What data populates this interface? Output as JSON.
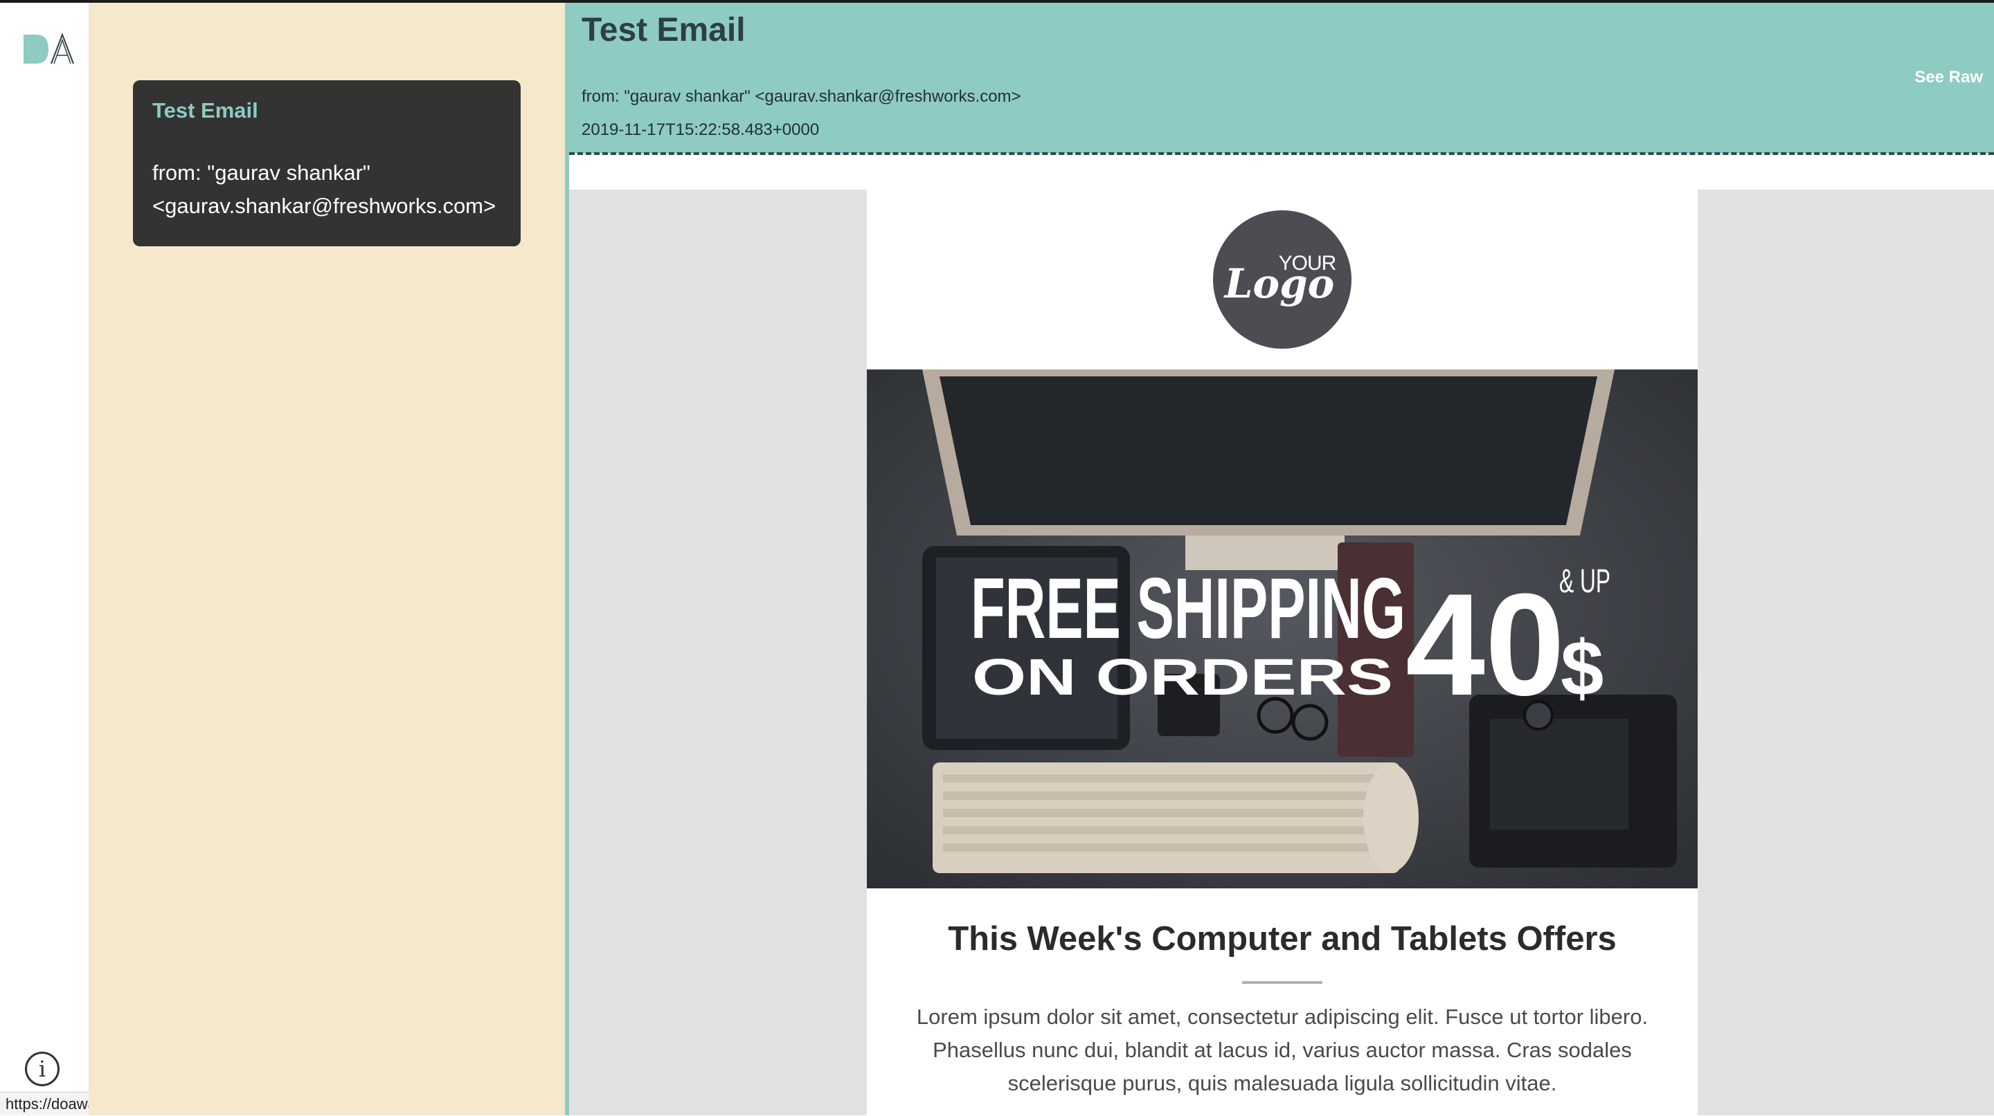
{
  "app": {
    "logo_text": "DA",
    "info_icon": "info-icon",
    "status_url": "https://doaway.netlify.com/#/"
  },
  "email_list": [
    {
      "subject": "Test Email",
      "from": "from: \"gaurav shankar\" <gaurav.shankar@freshworks.com>"
    }
  ],
  "email": {
    "title": "Test Email",
    "from": "from: \"gaurav shankar\" <gaurav.shankar@freshworks.com>",
    "date": "2019-11-17T15:22:58.483+0000",
    "see_raw_label": "See Raw"
  },
  "email_content": {
    "logo_your": "YOUR",
    "logo_word": "Logo",
    "hero_line1": "FREE SHIPPING",
    "hero_line2": "ON ORDERS",
    "hero_amount": "40",
    "hero_currency": "$",
    "hero_and_up": "& UP",
    "heading": "This Week's Computer and Tablets Offers",
    "body": "Lorem ipsum dolor sit amet, consectetur adipiscing elit. Fusce ut tortor libero. Phasellus nunc dui, blandit at lacus id, varius auctor massa. Cras sodales scelerisque purus, quis malesuada ligula sollicitudin vitae."
  },
  "colors": {
    "accent": "#8ecbc2",
    "list_bg": "#f5e8cb",
    "card_bg": "#333333",
    "header_text": "#2b3f45"
  }
}
